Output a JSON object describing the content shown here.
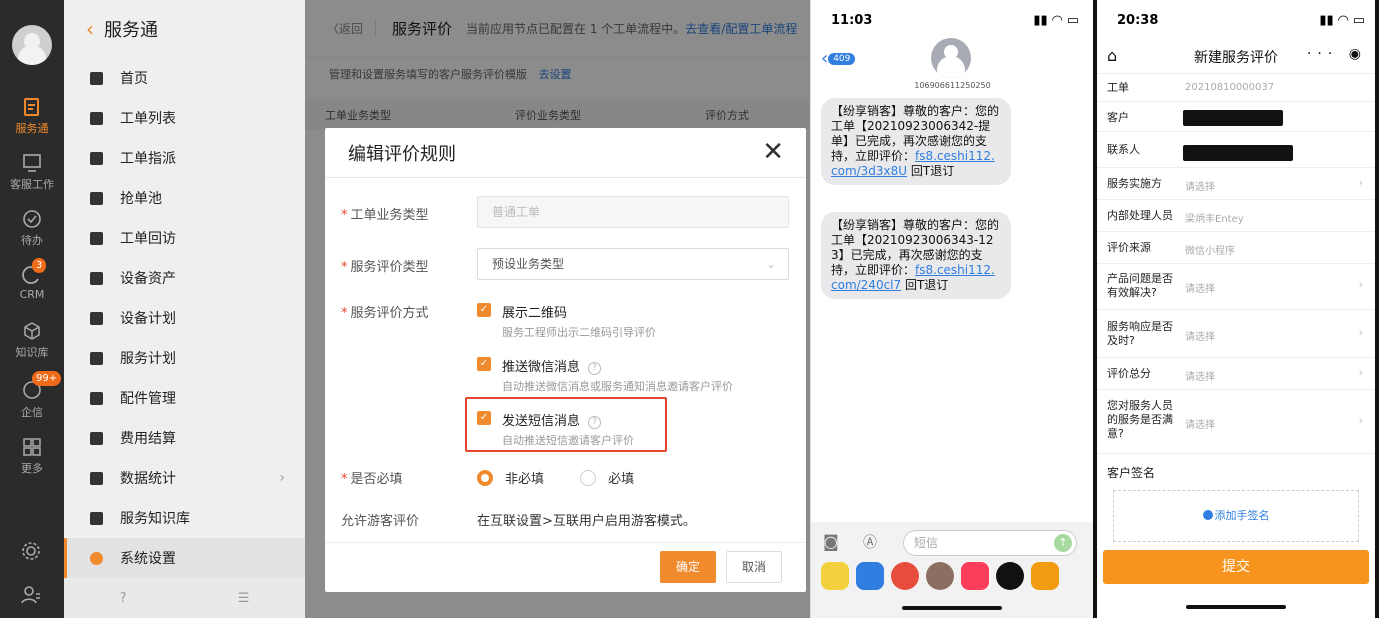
{
  "rail": {
    "items": [
      {
        "label": "服务通",
        "icon": "service-icon",
        "active": true
      },
      {
        "label": "客服工作",
        "icon": "monitor-icon"
      },
      {
        "label": "待办",
        "icon": "check-circle-icon"
      },
      {
        "label": "CRM",
        "icon": "crm-icon",
        "badge": "3"
      },
      {
        "label": "知识库",
        "icon": "cube-icon"
      },
      {
        "label": "企信",
        "icon": "chat-icon",
        "badge": "99+"
      },
      {
        "label": "更多",
        "icon": "grid-icon"
      }
    ]
  },
  "sidebar": {
    "title": "服务通",
    "items": [
      {
        "label": "首页",
        "icon": "home-icon"
      },
      {
        "label": "工单列表",
        "icon": "list-icon"
      },
      {
        "label": "工单指派",
        "icon": "assign-icon"
      },
      {
        "label": "抢单池",
        "icon": "pool-icon"
      },
      {
        "label": "工单回访",
        "icon": "revisit-icon"
      },
      {
        "label": "设备资产",
        "icon": "device-icon"
      },
      {
        "label": "设备计划",
        "icon": "device-plan-icon"
      },
      {
        "label": "服务计划",
        "icon": "service-plan-icon"
      },
      {
        "label": "配件管理",
        "icon": "parts-icon"
      },
      {
        "label": "费用结算",
        "icon": "settle-icon"
      },
      {
        "label": "数据统计",
        "icon": "chart-icon",
        "arrow": true
      },
      {
        "label": "服务知识库",
        "icon": "book-icon"
      },
      {
        "label": "系统设置",
        "icon": "settings-icon",
        "active": true
      }
    ]
  },
  "main": {
    "back": "〈返回",
    "title": "服务评价",
    "note": "当前应用节点已配置在 1 个工单流程中。",
    "note_link": "去查看/配置工单流程",
    "subline": "管理和设置服务填写的客户服务评价模版",
    "subline_link": "去设置",
    "columns": [
      "工单业务类型",
      "评价业务类型",
      "评价方式"
    ]
  },
  "dialog": {
    "title": "编辑评价规则",
    "order_type_label": "工单业务类型",
    "order_type_value": "普通工单",
    "eval_type_label": "服务评价类型",
    "eval_type_value": "预设业务类型",
    "eval_method_label": "服务评价方式",
    "options": [
      {
        "title": "展示二维码",
        "desc": "服务工程师出示二维码引导评价",
        "help": false
      },
      {
        "title": "推送微信消息",
        "desc": "自动推送微信消息或服务通知消息邀请客户评价",
        "help": true
      },
      {
        "title": "发送短信消息",
        "desc": "自动推送短信邀请客户评价",
        "help": true
      }
    ],
    "required_label": "是否必填",
    "radio_no": "非必填",
    "radio_yes": "必填",
    "guest_label": "允许游客评价",
    "guest_value": "在互联设置>互联用户启用游客模式。",
    "ok": "确定",
    "cancel": "取消"
  },
  "sms_phone": {
    "time": "11:03",
    "back_count": "409",
    "number": "106906611250250",
    "messages": [
      {
        "text": "【纷享销客】尊敬的客户：您的工单【20210923006342-提单】已完成，再次感谢您的支持，立即评价：",
        "url": "fs8.ceshi112.com/3d3x8U",
        "tail": " 回T退订"
      },
      {
        "text": "【纷享销客】尊敬的客户：您的工单【20210923006343-123】已完成，再次感谢您的支持，立即评价：",
        "url": "fs8.ceshi112.com/240cl7",
        "tail": " 回T退订"
      }
    ],
    "input_placeholder": "短信"
  },
  "form_phone": {
    "time": "20:38",
    "title": "新建服务评价",
    "rows": [
      {
        "label": "工单",
        "value": "20210810000037"
      },
      {
        "label": "客户",
        "value": "",
        "redacted": true
      },
      {
        "label": "联系人",
        "value": "",
        "redacted": true
      },
      {
        "label": "服务实施方",
        "value": "请选择",
        "arrow": true
      },
      {
        "label": "内部处理人员",
        "value": "梁炳丰Entey"
      },
      {
        "label": "评价来源",
        "value": "微信小程序"
      },
      {
        "label": "产品问题是否有效解决?",
        "value": "请选择",
        "arrow": true
      },
      {
        "label": "服务响应是否及时?",
        "value": "请选择",
        "arrow": true
      },
      {
        "label": "评价总分",
        "value": "请选择",
        "arrow": true
      },
      {
        "label": "您对服务人员的服务是否满意?",
        "value": "请选择",
        "arrow": true
      }
    ],
    "sign_label": "客户签名",
    "sign_add": "添加手签名",
    "submit": "提交"
  }
}
